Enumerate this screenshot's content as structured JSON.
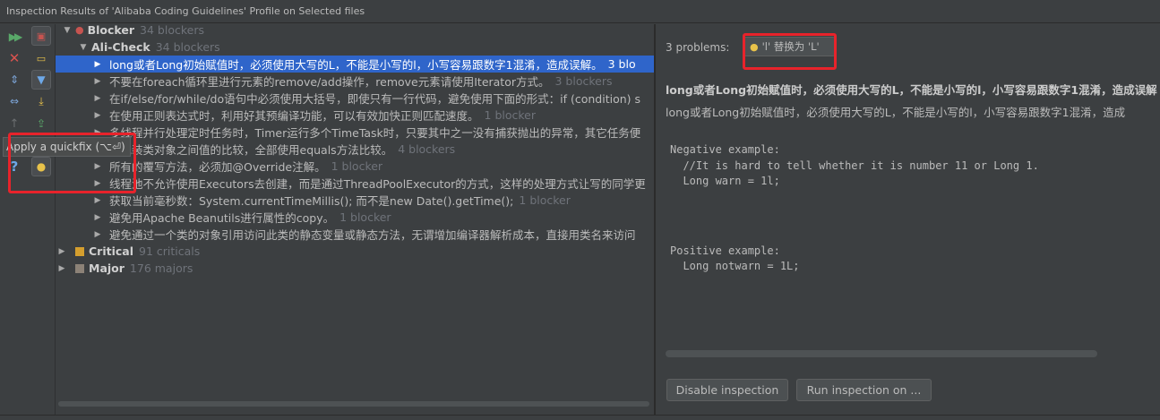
{
  "window": {
    "title": "Inspection Results of 'Alibaba Coding Guidelines' Profile on Selected files"
  },
  "toolbar": {
    "tooltip": "Apply a quickfix (⌥⏎)",
    "help_label": "?"
  },
  "tree": {
    "groups": [
      {
        "label": "Blocker",
        "count": "34 blockers",
        "color": "#c75450",
        "severity_icon": "error-icon"
      },
      {
        "label": "Critical",
        "count": "91 criticals",
        "color": "#d49e2e"
      },
      {
        "label": "Major",
        "count": "176 majors",
        "color": "#8c8277"
      }
    ],
    "subgroup": {
      "label": "Ali-Check",
      "count": "34 blockers"
    },
    "items": [
      {
        "text": "long或者Long初始赋值时，必须使用大写的L，不能是小写的l，小写容易跟数字1混淆，造成误解。",
        "count": "3 blo"
      },
      {
        "text": "不要在foreach循环里进行元素的remove/add操作，remove元素请使用Iterator方式。",
        "count": "3 blockers"
      },
      {
        "text": "在if/else/for/while/do语句中必须使用大括号，即使只有一行代码，避免使用下面的形式：if (condition) s",
        "count": ""
      },
      {
        "text": "在使用正则表达式时，利用好其预编译功能，可以有效加快正则匹配速度。",
        "count": "1 blocker"
      },
      {
        "text": "多线程并行处理定时任务时，Timer运行多个TimeTask时，只要其中之一没有捕获抛出的异常，其它任务便",
        "count": ""
      },
      {
        "text": "的包装类对象之间值的比较，全部使用equals方法比较。",
        "count": "4 blockers"
      },
      {
        "text": "所有的覆写方法，必须加@Override注解。",
        "count": "1 blocker"
      },
      {
        "text": "线程池不允许使用Executors去创建，而是通过ThreadPoolExecutor的方式，这样的处理方式让写的同学更",
        "count": ""
      },
      {
        "text": "获取当前毫秒数：System.currentTimeMillis(); 而不是new Date().getTime();",
        "count": "1 blocker"
      },
      {
        "text": "避免用Apache Beanutils进行属性的copy。",
        "count": "1 blocker"
      },
      {
        "text": "避免通过一个类的对象引用访问此类的静态变量或静态方法，无谓增加编译器解析成本，直接用类名来访问",
        "count": ""
      }
    ]
  },
  "details": {
    "problems_label": "3 problems:",
    "quickfix_label": "'l' 替换为 'L'",
    "title_bold": "long或者Long初始赋值时，必须使用大写的L，不能是小写的l，小写容易跟数字1混淆，造成误解",
    "description": "long或者Long初始赋值时，必须使用大写的L，不能是小写的l，小写容易跟数字1混淆，造成",
    "negative_header": "Negative example:",
    "negative_comment": "  //It is hard to tell whether it is number 11 or Long 1.",
    "negative_code": "  Long warn = 1l;",
    "positive_header": "Positive example:",
    "positive_code": "  Long notwarn = 1L;",
    "disable_button": "Disable inspection",
    "run_button": "Run inspection on ..."
  },
  "accent_color": "#2f65ca",
  "highlight_color": "#e8232b"
}
